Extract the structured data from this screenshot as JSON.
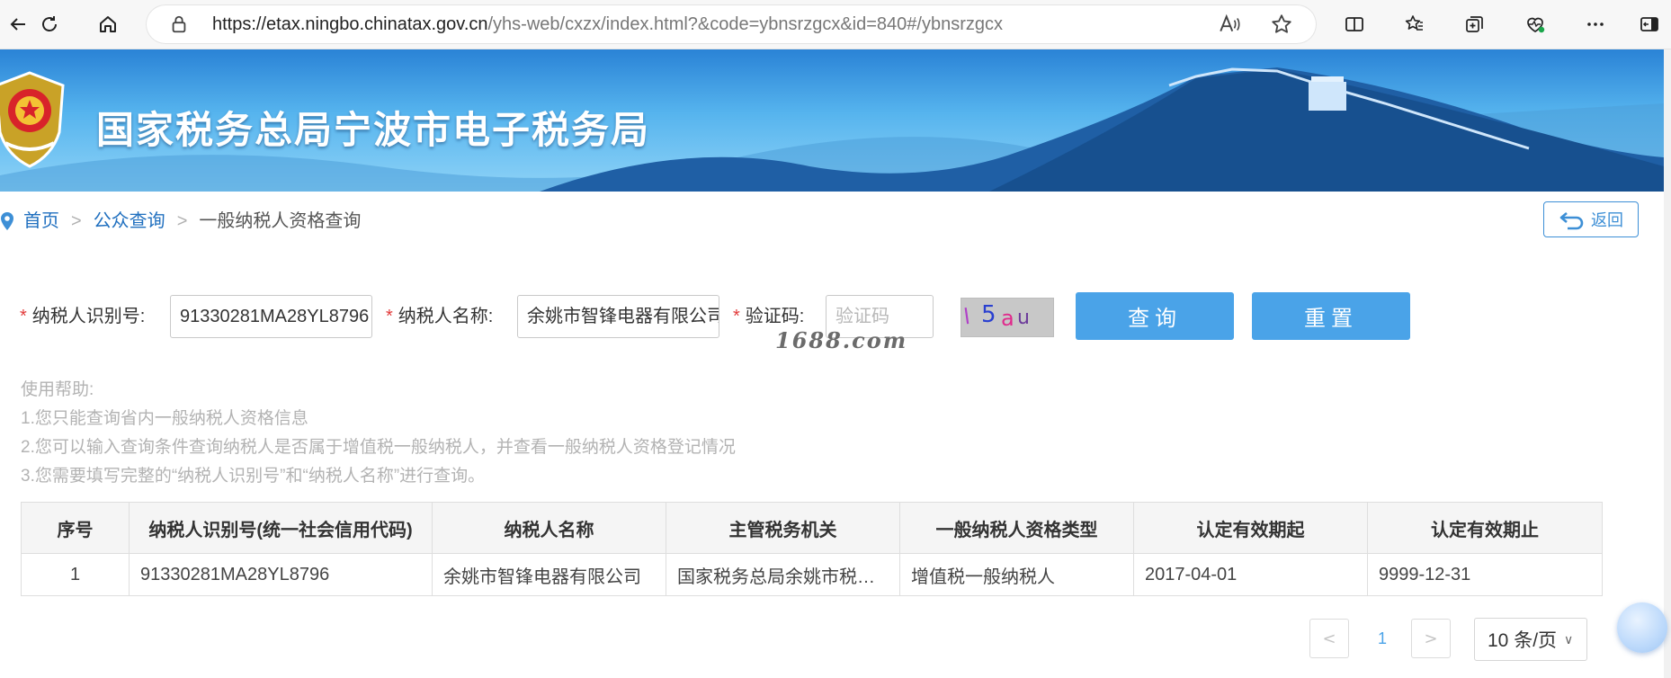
{
  "browser": {
    "url_host": "https://etax.ningbo.chinatax.gov.cn",
    "url_path": "/yhs-web/cxzx/index.html?&code=ybnsrzgcx&id=840#/ybnsrzgcx"
  },
  "banner": {
    "title": "国家税务总局宁波市电子税务局"
  },
  "breadcrumb": {
    "home": "首页",
    "separator": ">",
    "public_query": "公众查询",
    "current": "一般纳税人资格查询"
  },
  "back_button": {
    "label": "返回"
  },
  "form": {
    "required_mark": "*",
    "taxpayer_id_label": "纳税人识别号:",
    "taxpayer_id_value": "91330281MA28YL8796",
    "taxpayer_name_label": "纳税人名称:",
    "taxpayer_name_value": "余姚市智锋电器有限公司",
    "captcha_label": "验证码:",
    "captcha_placeholder": "验证码",
    "captcha_text": [
      "l",
      "5",
      "a",
      "u"
    ],
    "query_button": "查询",
    "reset_button": "重置"
  },
  "watermark": "1688.com",
  "help": {
    "title": "使用帮助:",
    "lines": [
      "1.您只能查询省内一般纳税人资格信息",
      "2.您可以输入查询条件查询纳税人是否属于增值税一般纳税人，并查看一般纳税人资格登记情况",
      "3.您需要填写完整的“纳税人识别号”和“纳税人名称”进行查询。"
    ]
  },
  "table": {
    "headers": [
      "序号",
      "纳税人识别号(统一社会信用代码)",
      "纳税人名称",
      "主管税务机关",
      "一般纳税人资格类型",
      "认定有效期起",
      "认定有效期止"
    ],
    "rows": [
      [
        "1",
        "91330281MA28YL8796",
        "余姚市智锋电器有限公司",
        "国家税务总局余姚市税…",
        "增值税一般纳税人",
        "2017-04-01",
        "9999-12-31"
      ]
    ]
  },
  "pagination": {
    "prev": "<",
    "current_page": "1",
    "next": ">",
    "page_size": "10 条/页"
  },
  "colors": {
    "accent": "#4aa3e8",
    "link": "#1f6fbf",
    "required": "#e23b3b"
  }
}
